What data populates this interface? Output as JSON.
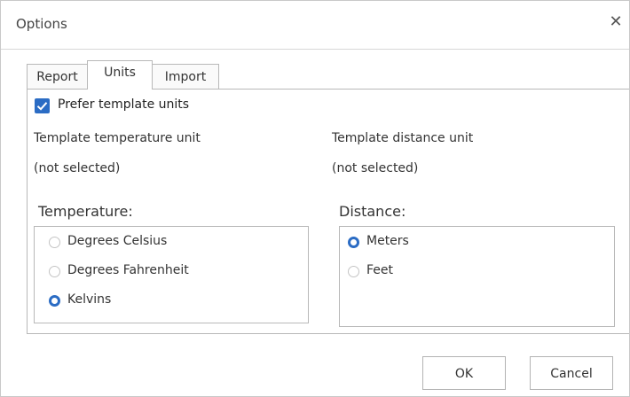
{
  "dialog": {
    "title": "Options",
    "close_glyph": "✕"
  },
  "tabs": [
    {
      "label": "Report",
      "active": false
    },
    {
      "label": "Units",
      "active": true
    },
    {
      "label": "Import",
      "active": false
    }
  ],
  "units": {
    "prefer_template_label": "Prefer template units",
    "prefer_template_checked": true,
    "template_temperature_label": "Template temperature unit",
    "template_temperature_value": "(not selected)",
    "template_distance_label": "Template distance unit",
    "template_distance_value": "(not selected)",
    "temperature": {
      "title": "Temperature:",
      "options": [
        {
          "label": "Degrees Celsius",
          "selected": false
        },
        {
          "label": "Degrees Fahrenheit",
          "selected": false
        },
        {
          "label": "Kelvins",
          "selected": true
        }
      ]
    },
    "distance": {
      "title": "Distance:",
      "options": [
        {
          "label": "Meters",
          "selected": true
        },
        {
          "label": "Feet",
          "selected": false
        }
      ]
    }
  },
  "buttons": {
    "ok": "OK",
    "cancel": "Cancel"
  },
  "colors": {
    "accent": "#2b6cc4",
    "border": "#b8b8b8"
  },
  "icons": {
    "close": "close-icon",
    "check": "checkmark-icon"
  }
}
